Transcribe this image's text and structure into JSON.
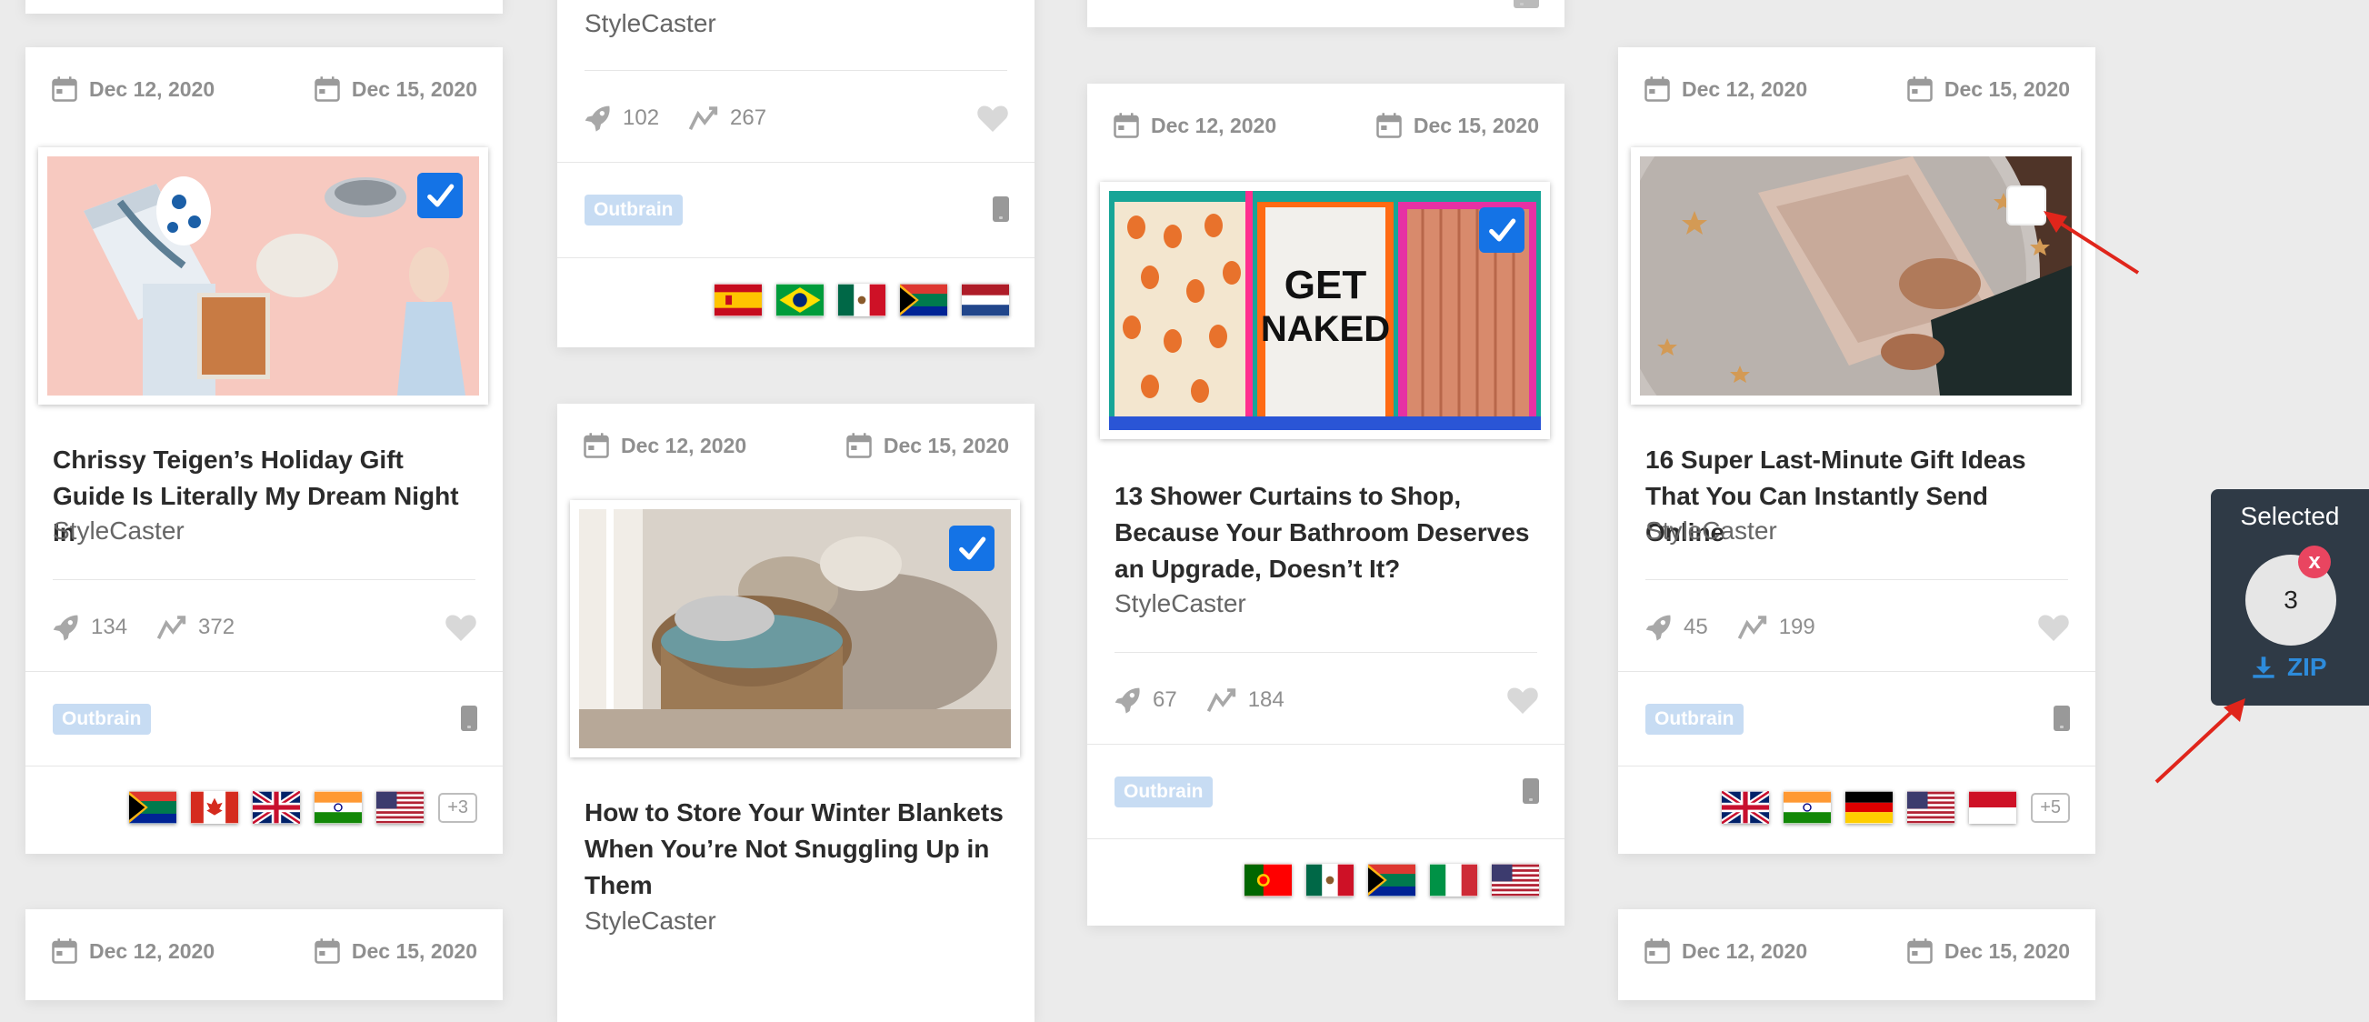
{
  "dates": {
    "start": "Dec 12, 2020",
    "end": "Dec 15, 2020"
  },
  "badge": "Outbrain",
  "cards": [
    {
      "title": "Chrissy Teigen’s Holiday Gift Guide Is Literally My Dream Night In",
      "source": "StyleCaster",
      "shares": "134",
      "trend": "372",
      "flags": [
        "za",
        "ca",
        "gb",
        "in",
        "us"
      ],
      "more": "+3",
      "checked": true
    },
    {
      "source": "StyleCaster",
      "shares": "102",
      "trend": "267",
      "flags": [
        "es",
        "br",
        "mx",
        "za",
        "nl"
      ]
    },
    {
      "title": "How to Store Your Winter Blankets When You’re Not Snuggling Up in Them",
      "source": "StyleCaster",
      "checked": true
    },
    {
      "title": "13 Shower Curtains to Shop, Because Your Bathroom Deserves an Upgrade, Doesn’t It?",
      "source": "StyleCaster",
      "shares": "67",
      "trend": "184",
      "flags": [
        "pt",
        "mx",
        "za",
        "it",
        "us"
      ],
      "checked": true
    },
    {
      "title": "16 Super Last-Minute Gift Ideas That You Can Instantly Send Online",
      "source": "StyleCaster",
      "shares": "45",
      "trend": "199",
      "flags": [
        "gb",
        "in",
        "de",
        "us",
        "id"
      ],
      "more": "+5",
      "checked": false
    }
  ],
  "selection": {
    "label": "Selected",
    "count": "3",
    "clear": "x",
    "download": "ZIP"
  },
  "icons": [
    "calendar-icon",
    "rocket-icon",
    "trend-icon",
    "heart-icon",
    "mobile-icon",
    "download-icon",
    "check-icon"
  ],
  "colors": {
    "accent": "#1473e6",
    "badge": "#c7dcf3",
    "panel": "#2f3a46",
    "zip": "#2d8bdb",
    "clear": "#e94560",
    "arrow": "#e0251b"
  }
}
